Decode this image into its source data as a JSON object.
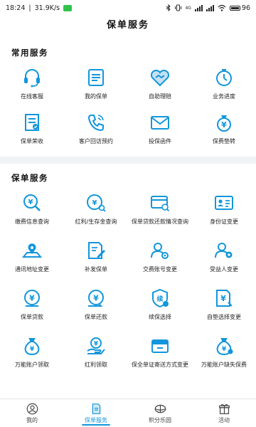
{
  "status_bar": {
    "time": "18:24",
    "network_speed": "31.9K/s",
    "network_type": "4G",
    "battery": "96"
  },
  "header": {
    "title": "保单服务"
  },
  "common_services": {
    "title": "常用服务",
    "items": [
      {
        "label": "在线客服",
        "icon": "headset-icon"
      },
      {
        "label": "我的保单",
        "icon": "policy-document-icon"
      },
      {
        "label": "自助理赔",
        "icon": "handshake-icon"
      },
      {
        "label": "业务进度",
        "icon": "progress-clock-icon"
      },
      {
        "label": "保单荣收",
        "icon": "receipt-icon"
      },
      {
        "label": "客户回访预约",
        "icon": "phone-icon"
      },
      {
        "label": "投保函件",
        "icon": "envelope-icon"
      },
      {
        "label": "保费垫转",
        "icon": "yuan-bag-icon"
      }
    ]
  },
  "policy_services": {
    "title": "保单服务",
    "items": [
      {
        "label": "缴费信息查询",
        "icon": "yuan-search-icon"
      },
      {
        "label": "红利/生存金查询",
        "icon": "yuan-magnifier-icon"
      },
      {
        "label": "保单贷款还款情况查询",
        "icon": "card-search-icon"
      },
      {
        "label": "身份证变更",
        "icon": "id-card-icon"
      },
      {
        "label": "通讯地址变更",
        "icon": "map-pin-icon"
      },
      {
        "label": "补发保单",
        "icon": "edit-document-icon"
      },
      {
        "label": "交费账号变更",
        "icon": "user-gear-icon"
      },
      {
        "label": "受益人变更",
        "icon": "users-icon"
      },
      {
        "label": "保单贷款",
        "icon": "yuan-circle-icon"
      },
      {
        "label": "保单还款",
        "icon": "yuan-return-icon"
      },
      {
        "label": "续保选择",
        "icon": "renew-shield-icon"
      },
      {
        "label": "自垫选择变更",
        "icon": "yuan-document-icon"
      },
      {
        "label": "万能账户领取",
        "icon": "money-bag-icon"
      },
      {
        "label": "红利领取",
        "icon": "yuan-hand-icon"
      },
      {
        "label": "保全单证寄送方式变更",
        "icon": "mail-box-icon"
      },
      {
        "label": "万能账户缺失保费",
        "icon": "money-bag-alert-icon"
      }
    ]
  },
  "bottom_nav": {
    "items": [
      {
        "label": "我的",
        "icon": "profile-icon"
      },
      {
        "label": "保单服务",
        "icon": "policy-nav-icon"
      },
      {
        "label": "积分乐园",
        "icon": "points-icon"
      },
      {
        "label": "活动",
        "icon": "gift-icon"
      }
    ],
    "active_index": 1
  },
  "colors": {
    "accent": "#1296db",
    "background": "#f2f3f5",
    "card": "#ffffff",
    "text": "#222222"
  }
}
